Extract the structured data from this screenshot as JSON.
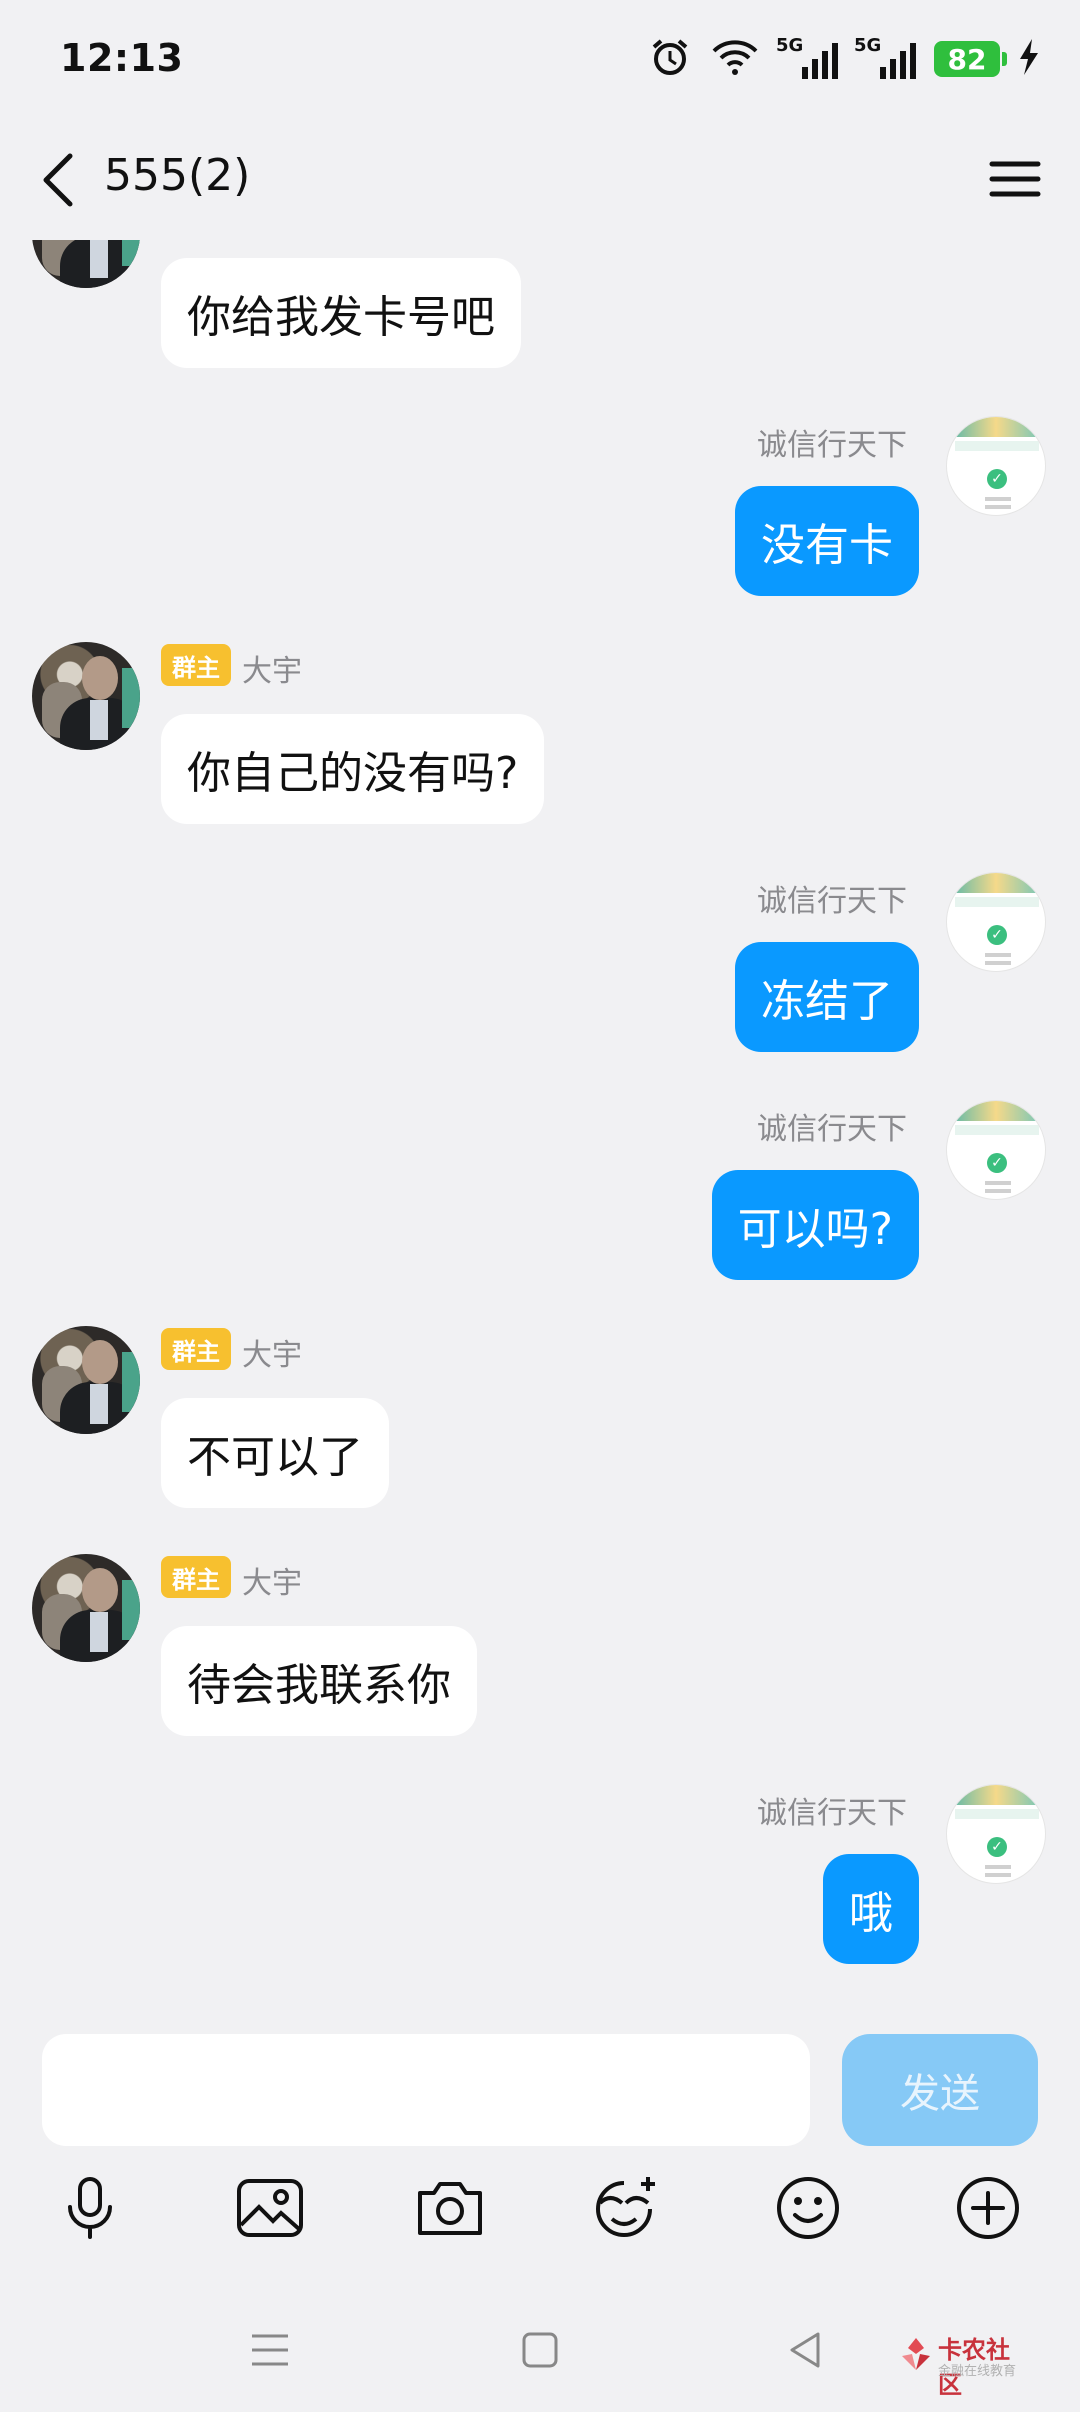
{
  "status_bar": {
    "time": "12:13",
    "signal_tag_1": "5G",
    "signal_tag_2": "5G",
    "battery": "82",
    "icons": [
      "alarm-icon",
      "wifi-icon",
      "signal-icon",
      "signal-icon",
      "battery-icon",
      "charging-icon"
    ]
  },
  "header": {
    "title": "555(2)",
    "back_icon": "chevron-left-icon",
    "menu_icon": "menu-icon"
  },
  "messages": [
    {
      "side": "left",
      "text": "你给我发卡号吧"
    },
    {
      "side": "right",
      "sender": "诚信行天下",
      "text": "没有卡"
    },
    {
      "side": "left",
      "badge": "群主",
      "sender": "大宇",
      "text": "你自己的没有吗?"
    },
    {
      "side": "right",
      "sender": "诚信行天下",
      "text": "冻结了"
    },
    {
      "side": "right",
      "sender": "诚信行天下",
      "text": "可以吗?"
    },
    {
      "side": "left",
      "badge": "群主",
      "sender": "大宇",
      "text": "不可以了"
    },
    {
      "side": "left",
      "badge": "群主",
      "sender": "大宇",
      "text": "待会我联系你"
    },
    {
      "side": "right",
      "sender": "诚信行天下",
      "text": "哦"
    }
  ],
  "input": {
    "value": "",
    "send_label": "发送"
  },
  "toolbar": {
    "icons": [
      "microphone-icon",
      "image-icon",
      "camera-icon",
      "sticker-icon",
      "emoji-icon",
      "plus-icon"
    ]
  },
  "navbar": {
    "icons": [
      "recents-icon",
      "home-icon",
      "back-icon"
    ]
  },
  "watermark": {
    "title": "卡农社区",
    "subtitle": "金融在线教育"
  },
  "colors": {
    "outgoing_bubble": "#0a99ff",
    "incoming_bubble": "#ffffff",
    "badge": "#f7c02f",
    "send_button": "#86c9f6",
    "background": "#f1f1f3"
  }
}
